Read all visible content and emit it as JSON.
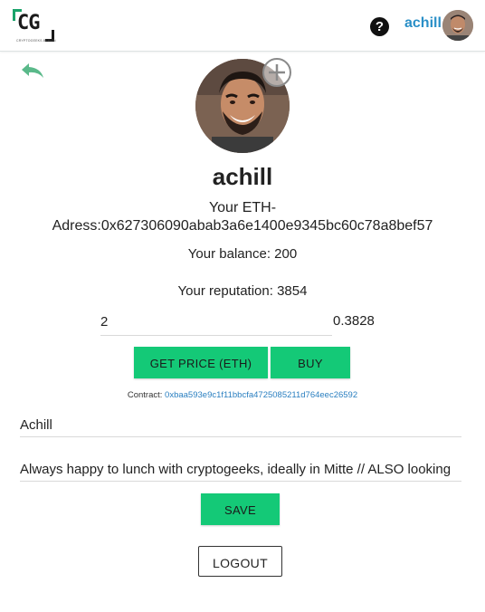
{
  "header": {
    "logo_text": "CG",
    "logo_tagline": "CRYPTOGEEKS.BERLIN",
    "help_symbol": "?",
    "username": "achill"
  },
  "profile": {
    "display_name": "achill",
    "eth_label": "Your ETH-",
    "eth_address": "Adress:0x627306090abab3a6e1400e9345bc60c78a8bef57",
    "balance": "Your balance: 200",
    "reputation": "Your reputation: 3854"
  },
  "purchase": {
    "amount_value": "2",
    "price_value": "0.3828",
    "get_price_label": "GET PRICE (ETH)",
    "buy_label": "BUY",
    "contract_label": "Contract: ",
    "contract_address": "0xbaa593e9c1f11bbcfa4725085211d764eec26592"
  },
  "form": {
    "name_value": "Achill",
    "bio_value": "Always happy to lunch with cryptogeeks, ideally in Mitte // ALSO looking",
    "save_label": "SAVE",
    "logout_label": "LOGOUT"
  },
  "colors": {
    "accent_green": "#14c977",
    "link_blue": "#2a8fc7",
    "logo_green": "#19a36a"
  },
  "icons": {
    "help": "help-icon",
    "back": "back-arrow-icon",
    "add_photo": "add-photo-icon"
  }
}
